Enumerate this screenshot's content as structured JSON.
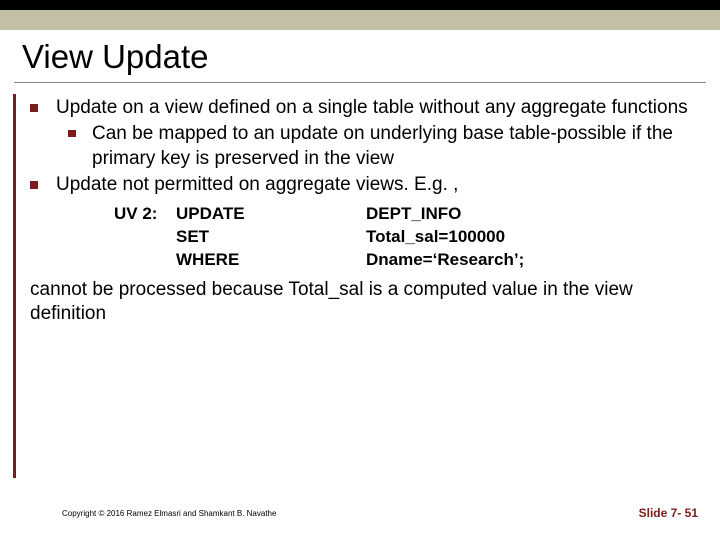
{
  "title": "View Update",
  "bullets": {
    "b1": "Update on a view defined on a single table without any aggregate functions",
    "b1a": "Can be mapped to an update on underlying base table-possible if the primary key is preserved in the view",
    "b2": "Update not permitted on aggregate views. E.g. ,"
  },
  "code": {
    "label": "UV 2:",
    "kw1": "UPDATE",
    "val1": "DEPT_INFO",
    "kw2": "SET",
    "val2": "Total_sal=100000",
    "kw3": "WHERE",
    "val3": "Dname=‘Research’;"
  },
  "closing": "cannot be processed because Total_sal is a computed value in the view definition",
  "footer": {
    "copyright": "Copyright © 2016 Ramez Elmasri and Shamkant B. Navathe",
    "slide": "Slide 7- 51"
  }
}
